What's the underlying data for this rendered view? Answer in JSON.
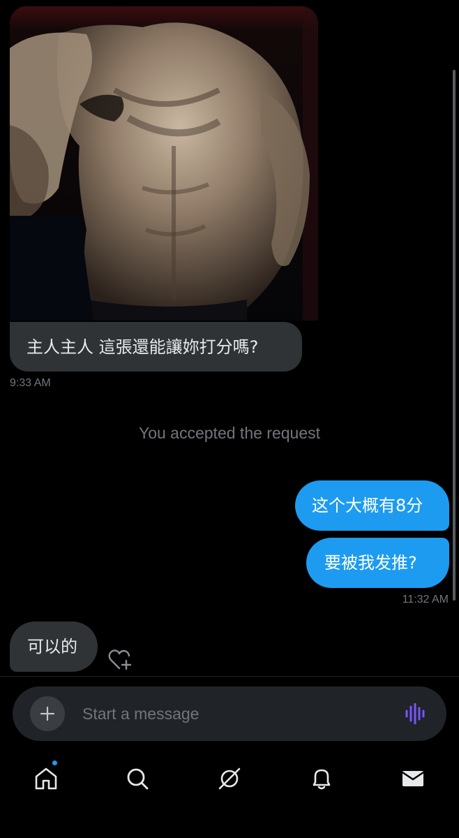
{
  "conversation": {
    "messages": [
      {
        "direction": "incoming",
        "type": "image",
        "image_description": "photo"
      },
      {
        "direction": "incoming",
        "type": "text",
        "text": "主人主人 這張還能讓妳打分嗎?",
        "timestamp": "9:33 AM"
      },
      {
        "direction": "system",
        "text": "You accepted the request"
      },
      {
        "direction": "outgoing",
        "type": "text",
        "text": "这个大概有8分"
      },
      {
        "direction": "outgoing",
        "type": "text",
        "text": "要被我发推?",
        "timestamp": "11:32 AM"
      },
      {
        "direction": "incoming",
        "type": "text",
        "text": "可以的"
      }
    ]
  },
  "composer": {
    "placeholder": "Start a message"
  },
  "tabbar": {
    "items": [
      {
        "icon": "home-icon",
        "active": true,
        "has_notification_dot": true
      },
      {
        "icon": "search-icon"
      },
      {
        "icon": "grok-icon"
      },
      {
        "icon": "bell-icon"
      },
      {
        "icon": "mail-icon",
        "active": true
      }
    ]
  },
  "colors": {
    "background": "#000000",
    "incoming_bubble": "#2f3336",
    "outgoing_bubble": "#1d9bf0",
    "muted_text": "#71767b",
    "voice_accent": "#7856ff"
  }
}
